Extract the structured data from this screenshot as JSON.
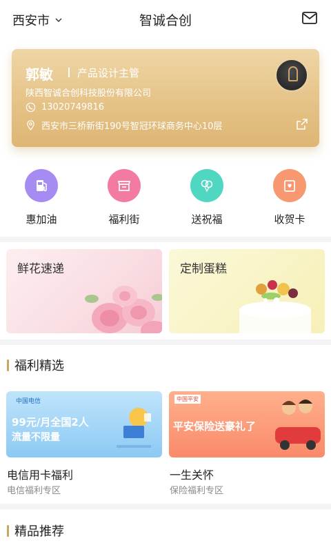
{
  "header": {
    "city": "西安市",
    "title": "智诚合创"
  },
  "card": {
    "name": "郭敏",
    "role": "产品设计主管",
    "company": "陕西智诚合创科技股份有限公司",
    "phone": "13020749816",
    "address": "西安市三桥新街190号智冠环球商务中心10层"
  },
  "quick_actions": [
    {
      "label": "惠加油",
      "icon": "gas-pump-icon",
      "color": "#a68cf2"
    },
    {
      "label": "福利街",
      "icon": "shop-icon",
      "color": "#f37ba2"
    },
    {
      "label": "送祝福",
      "icon": "balloon-icon",
      "color": "#4fd7c1"
    },
    {
      "label": "收贺卡",
      "icon": "card-icon",
      "color": "#f79870"
    }
  ],
  "promos": [
    {
      "title": "鲜花速递"
    },
    {
      "title": "定制蛋糕"
    }
  ],
  "sections": {
    "welfare": "福利精选",
    "recommend": "精品推荐"
  },
  "welfare_items": [
    {
      "title": "电信用卡福利",
      "subtitle": "电信福利专区",
      "banner_brand": "中国电信",
      "banner_line1": "99元/月全国2人",
      "banner_line2": "流量不限量"
    },
    {
      "title": "一生关怀",
      "subtitle": "保险福利专区",
      "banner_brand": "中国平安",
      "banner_line1": "平安保险送豪礼了"
    }
  ],
  "colors": {
    "accent_gold": "#c9a56b",
    "card_gold": "#e4c185"
  }
}
